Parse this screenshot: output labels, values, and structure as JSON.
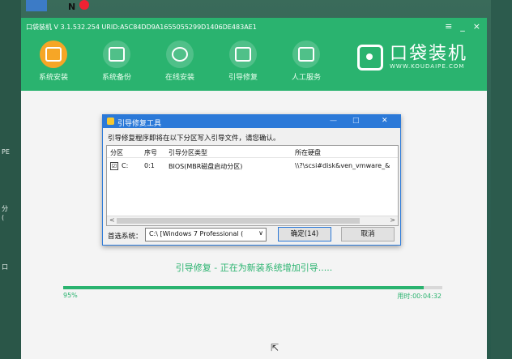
{
  "desktop": {
    "badge": "N",
    "left_labels": [
      "PE",
      "分",
      "(",
      "口"
    ]
  },
  "app": {
    "title": "口袋装机 V 3.1.532.254 URID:A5C84DD9A1655055299D1406DE483AE1",
    "controls": {
      "menu": "≡",
      "minimize": "_",
      "close": "×"
    },
    "nav": [
      {
        "label": "系统安装",
        "icon": "system-install-icon"
      },
      {
        "label": "系统备份",
        "icon": "system-backup-icon"
      },
      {
        "label": "在线安装",
        "icon": "online-install-icon"
      },
      {
        "label": "引导修复",
        "icon": "boot-repair-icon"
      },
      {
        "label": "人工服务",
        "icon": "chat-service-icon"
      }
    ],
    "brand": {
      "name": "口袋装机",
      "url": "WWW.KOUDAIPE.COM"
    },
    "accent": "#2ab36f",
    "active_nav": "#f6a626"
  },
  "dialog": {
    "title": "引导修复工具",
    "controls": {
      "minimize": "—",
      "maximize": "□",
      "close": "✕"
    },
    "message": "引导修复程序即将在以下分区写入引导文件，请您确认。",
    "columns": [
      "分区",
      "序号",
      "引导分区类型",
      "所在硬盘"
    ],
    "rows": [
      {
        "checked": "☑",
        "partition": "C:",
        "index": "0:1",
        "type": "BIOS(MBR磁盘启动分区)",
        "disk": "\\\\?\\scsi#disk&ven_vmware_&"
      }
    ],
    "scroll": {
      "left": "<",
      "right": ">"
    },
    "select_label": "首选系统：",
    "select_value": "C:\\ [Windows 7 Professional (",
    "select_arrow": "∨",
    "confirm_label": "确定(14)",
    "cancel_label": "取消"
  },
  "status": {
    "message": "引导修复 - 正在为新装系统增加引导.....",
    "progress_percent": 95,
    "progress_label": "95%",
    "elapsed": "用时:00:04:32"
  }
}
